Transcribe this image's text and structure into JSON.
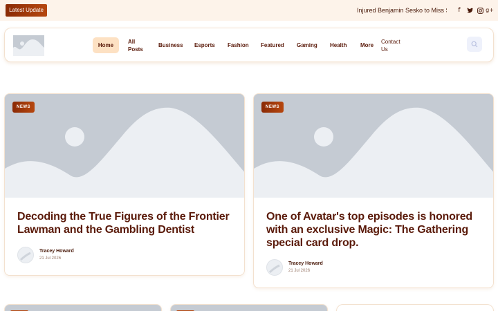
{
  "topbar": {
    "latest_label": "Latest Update",
    "ticker_text": "Injured Benjamin Sesko to Miss Slovenia's Crucial World Cup Qualifiers",
    "social": [
      {
        "name": "facebook-icon",
        "glyph": "f"
      },
      {
        "name": "twitter-icon",
        "glyph": "❧"
      },
      {
        "name": "instagram-icon",
        "glyph": "◎"
      },
      {
        "name": "google-plus-icon",
        "glyph": "g+"
      }
    ]
  },
  "nav": {
    "items": [
      {
        "label": "Home",
        "active": true
      },
      {
        "label": "All Posts"
      },
      {
        "label": "Business"
      },
      {
        "label": "Esports"
      },
      {
        "label": "Fashion"
      },
      {
        "label": "Featured"
      },
      {
        "label": "Gaming"
      },
      {
        "label": "Health"
      },
      {
        "label": "More"
      },
      {
        "label": "Contact Us"
      }
    ],
    "search_icon": "search-icon"
  },
  "posts": [
    {
      "badge": "NEWS",
      "title": "Decoding the True Figures of the Frontier Lawman and the Gambling Dentist",
      "author": "Tracey Howard",
      "date": "21 Jul 2026"
    },
    {
      "badge": "NEWS",
      "title": "One of Avatar's top episodes is honored with an exclusive Magic: The Gathering special card drop.",
      "author": "Tracey Howard",
      "date": "21 Jul 2026"
    }
  ],
  "colors": {
    "accent": "#a0370a",
    "title": "#5a1a0a",
    "active_nav": "#fde1c3",
    "placeholder": "#c5cbd3"
  }
}
